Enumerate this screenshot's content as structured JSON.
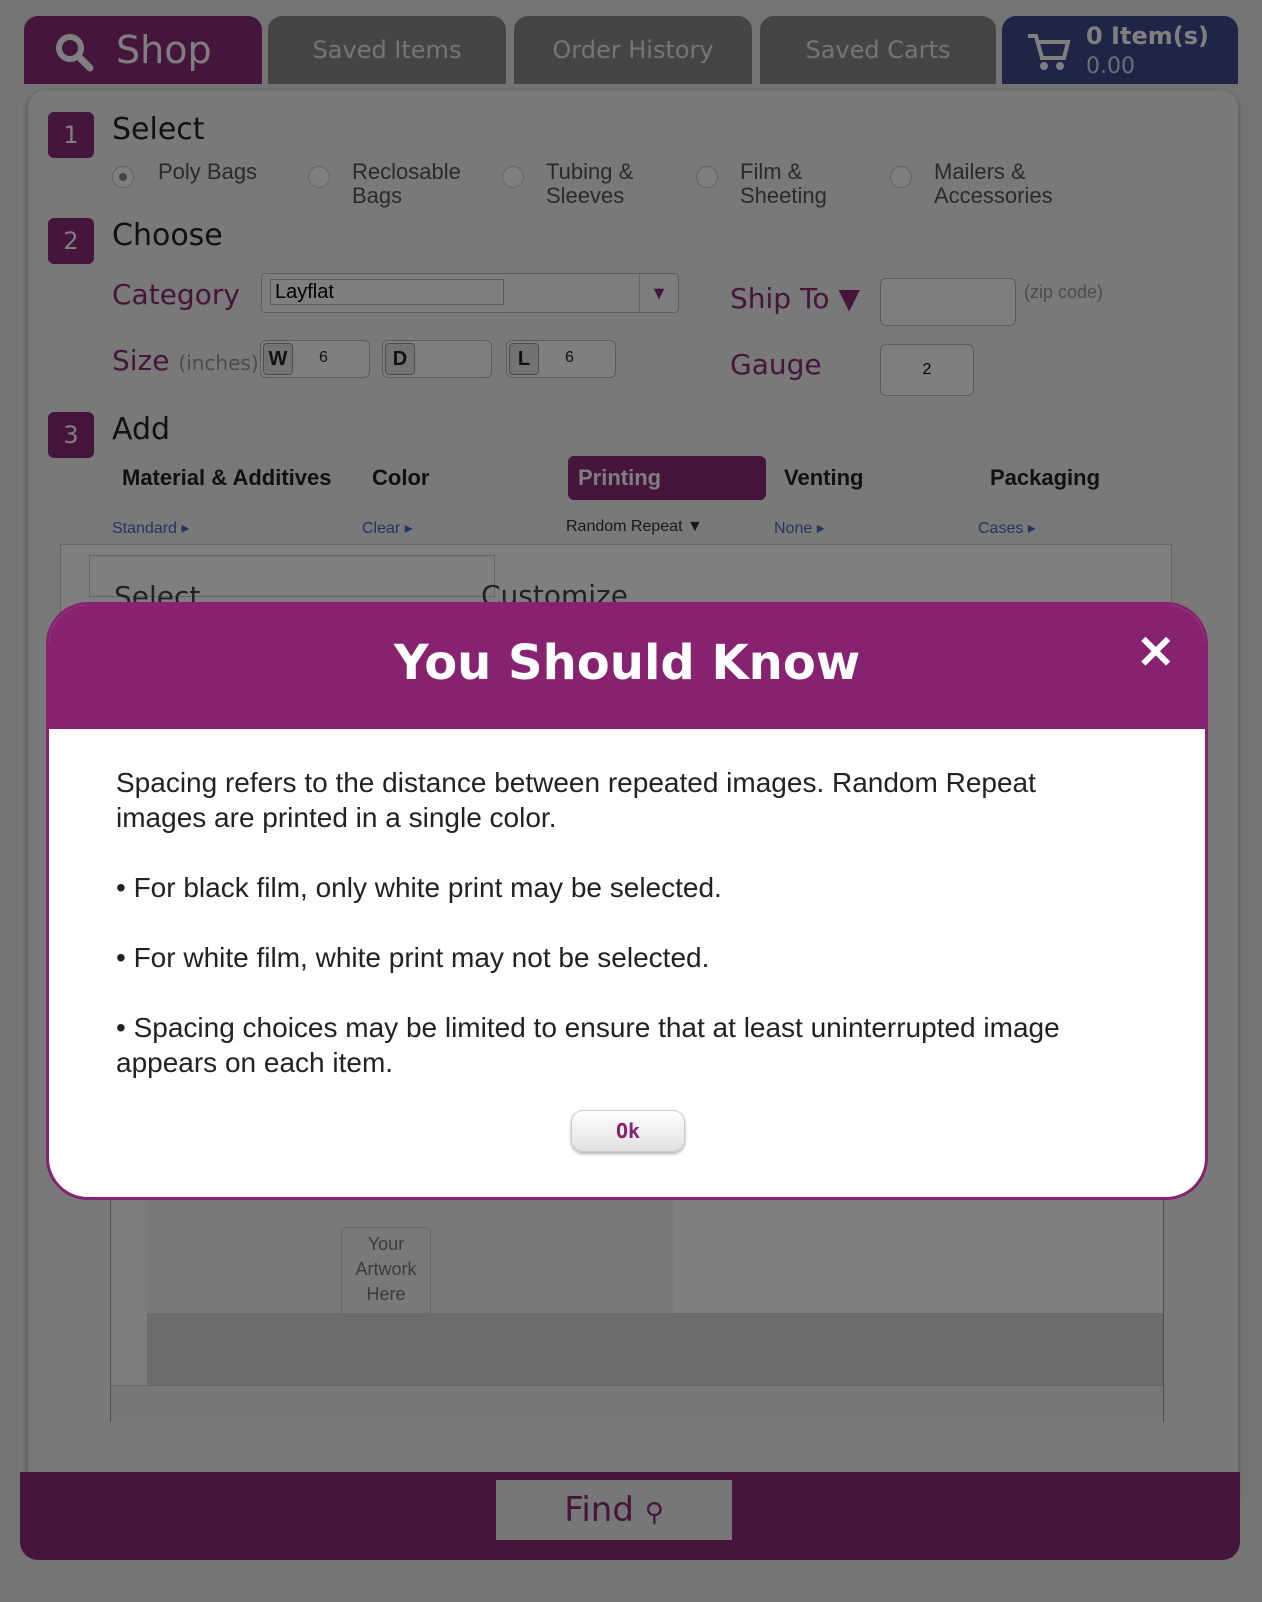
{
  "tabs": {
    "shop": "Shop",
    "saved_items": "Saved Items",
    "order_history": "Order History",
    "saved_carts": "Saved Carts"
  },
  "cart": {
    "count": "0 Item(s)",
    "total": "0.00"
  },
  "step1": {
    "number": "1",
    "title": "Select",
    "options": [
      "Poly Bags",
      "Reclosable\nBags",
      "Tubing &\nSleeves",
      "Film &\nSheeting",
      "Mailers &\nAccessories"
    ]
  },
  "step2": {
    "number": "2",
    "title": "Choose",
    "category_label": "Category",
    "category_value": "Layflat",
    "ship_to_label": "Ship To ▼",
    "zip_hint": "(zip code)",
    "size_label": "Size",
    "size_unit": "(inches)",
    "w_label": "W",
    "w_value": "6",
    "d_label": "D",
    "d_value": "",
    "l_label": "L",
    "l_value": "6",
    "gauge_label": "Gauge",
    "gauge_value": "2"
  },
  "step3": {
    "number": "3",
    "title": "Add",
    "tabs": [
      "Material & Additives",
      "Color",
      "Printing",
      "Venting",
      "Packaging"
    ],
    "sublinks": [
      "Standard ▸",
      "Clear ▸",
      "Random Repeat ▼",
      "None ▸",
      "Cases ▸"
    ],
    "select_label": "Select",
    "customize_label": "Customize",
    "artwork_placeholder": "Your Artwork Here"
  },
  "find": {
    "label": "Find"
  },
  "modal": {
    "title": "You Should Know",
    "close": "✕",
    "paragraphs": [
      "Spacing refers to the distance between repeated images. Random Repeat images are printed in a single color.",
      "• For black film, only white print may be selected.",
      "• For white film, white print may not be selected.",
      "• Spacing choices may be limited to ensure that at least uninterrupted image appears on each item."
    ],
    "ok": "Ok"
  }
}
